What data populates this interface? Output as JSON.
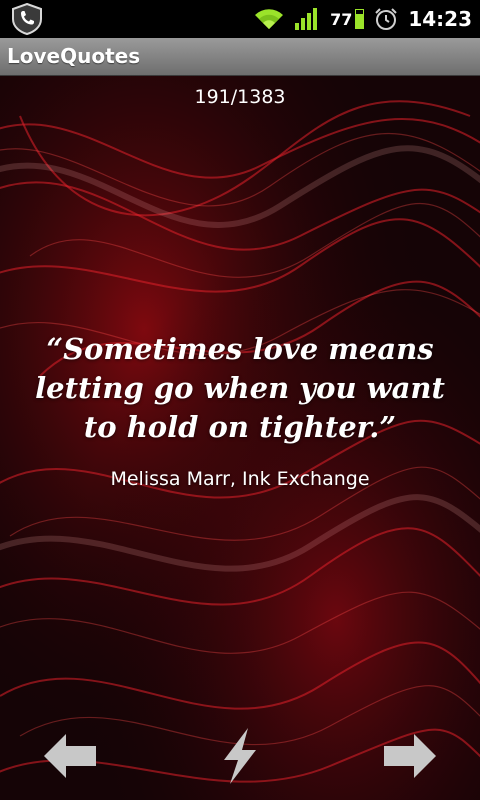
{
  "status_bar": {
    "battery_level": "77",
    "battery_fraction": 0.77,
    "time": "14:23",
    "icons": [
      "phone-shield-icon",
      "wifi-icon",
      "signal-icon",
      "battery-icon",
      "alarm-clock-icon"
    ],
    "accent_color": "#9be32a"
  },
  "app": {
    "title": "LoveQuotes"
  },
  "quote": {
    "counter": "191/1383",
    "text": "“Sometimes love means letting go when you want to hold on tighter.”",
    "author": "Melissa Marr, Ink Exchange"
  },
  "nav": {
    "icons": [
      "arrow-left-icon",
      "lightning-icon",
      "arrow-right-icon"
    ],
    "icon_color": "#c8c8c8"
  }
}
